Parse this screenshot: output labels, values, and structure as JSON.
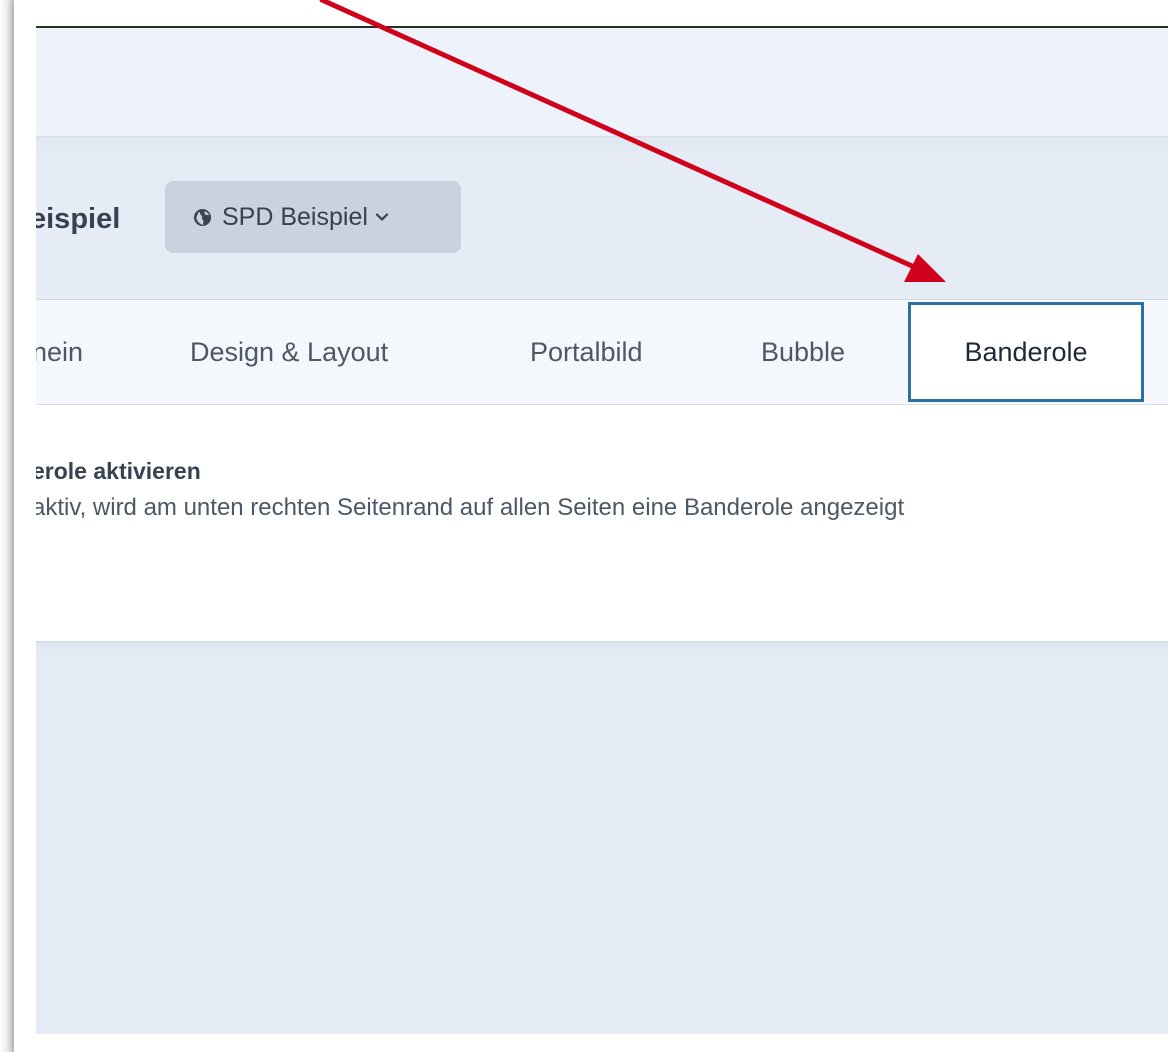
{
  "header": {
    "page_title": "eispiel",
    "site_select": {
      "icon": "globe-icon",
      "label": "SPD Beispiel",
      "chevron": "chevron-down-icon"
    }
  },
  "tabs": [
    {
      "label": "nein",
      "active": false
    },
    {
      "label": "Design & Layout",
      "active": false
    },
    {
      "label": "Portalbild",
      "active": false
    },
    {
      "label": "Bubble",
      "active": false
    },
    {
      "label": "Banderole",
      "active": true
    }
  ],
  "setting": {
    "title": "erole aktivieren",
    "description": "aktiv, wird am unten rechten Seitenrand auf allen Seiten eine Banderole angezeigt"
  },
  "colors": {
    "annotation_arrow": "#d0021b",
    "active_tab_border": "#2f6fa3",
    "header_background": "#e6ecf5",
    "select_background": "#c8d3df"
  }
}
